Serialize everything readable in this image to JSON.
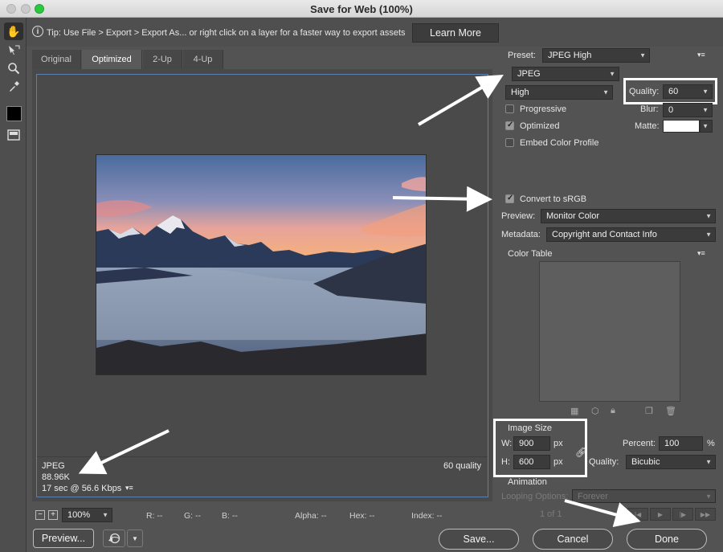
{
  "window": {
    "title": "Save for Web (100%)"
  },
  "tip": {
    "text": "Tip: Use File > Export > Export As... or right click on a layer for a faster way to export assets",
    "learn_more": "Learn More"
  },
  "tabs": [
    {
      "label": "Original"
    },
    {
      "label": "Optimized"
    },
    {
      "label": "2-Up"
    },
    {
      "label": "4-Up"
    }
  ],
  "preview_info": {
    "format": "JPEG",
    "size": "88.96K",
    "time": "17 sec @ 56.6 Kbps",
    "quality_text": "60 quality"
  },
  "status": {
    "zoom": "100%",
    "r": "R: --",
    "g": "G: --",
    "b": "B: --",
    "alpha": "Alpha: --",
    "hex": "Hex: --",
    "index": "Index: --"
  },
  "settings": {
    "preset_label": "Preset:",
    "preset_value": "JPEG High",
    "format_value": "JPEG",
    "compression_value": "High",
    "quality_label": "Quality:",
    "quality_value": "60",
    "progressive_label": "Progressive",
    "blur_label": "Blur:",
    "blur_value": "0",
    "optimized_label": "Optimized",
    "matte_label": "Matte:",
    "embed_label": "Embed Color Profile",
    "convert_label": "Convert to sRGB",
    "preview_label": "Preview:",
    "preview_value": "Monitor Color",
    "metadata_label": "Metadata:",
    "metadata_value": "Copyright and Contact Info",
    "color_table_label": "Color Table"
  },
  "image_size": {
    "header": "Image Size",
    "w_label": "W:",
    "w_value": "900",
    "h_label": "H:",
    "h_value": "600",
    "unit": "px",
    "percent_label": "Percent:",
    "percent_value": "100",
    "percent_unit": "%",
    "quality_label": "Quality:",
    "quality_value": "Bicubic"
  },
  "animation": {
    "header": "Animation",
    "looping_label": "Looping Options:",
    "looping_value": "Forever",
    "frame_counter": "1 of 1"
  },
  "buttons": {
    "preview": "Preview...",
    "save": "Save...",
    "cancel": "Cancel",
    "done": "Done"
  },
  "colors": {
    "accent_frame": "#5b7fb3",
    "annotation": "#ffffff"
  }
}
